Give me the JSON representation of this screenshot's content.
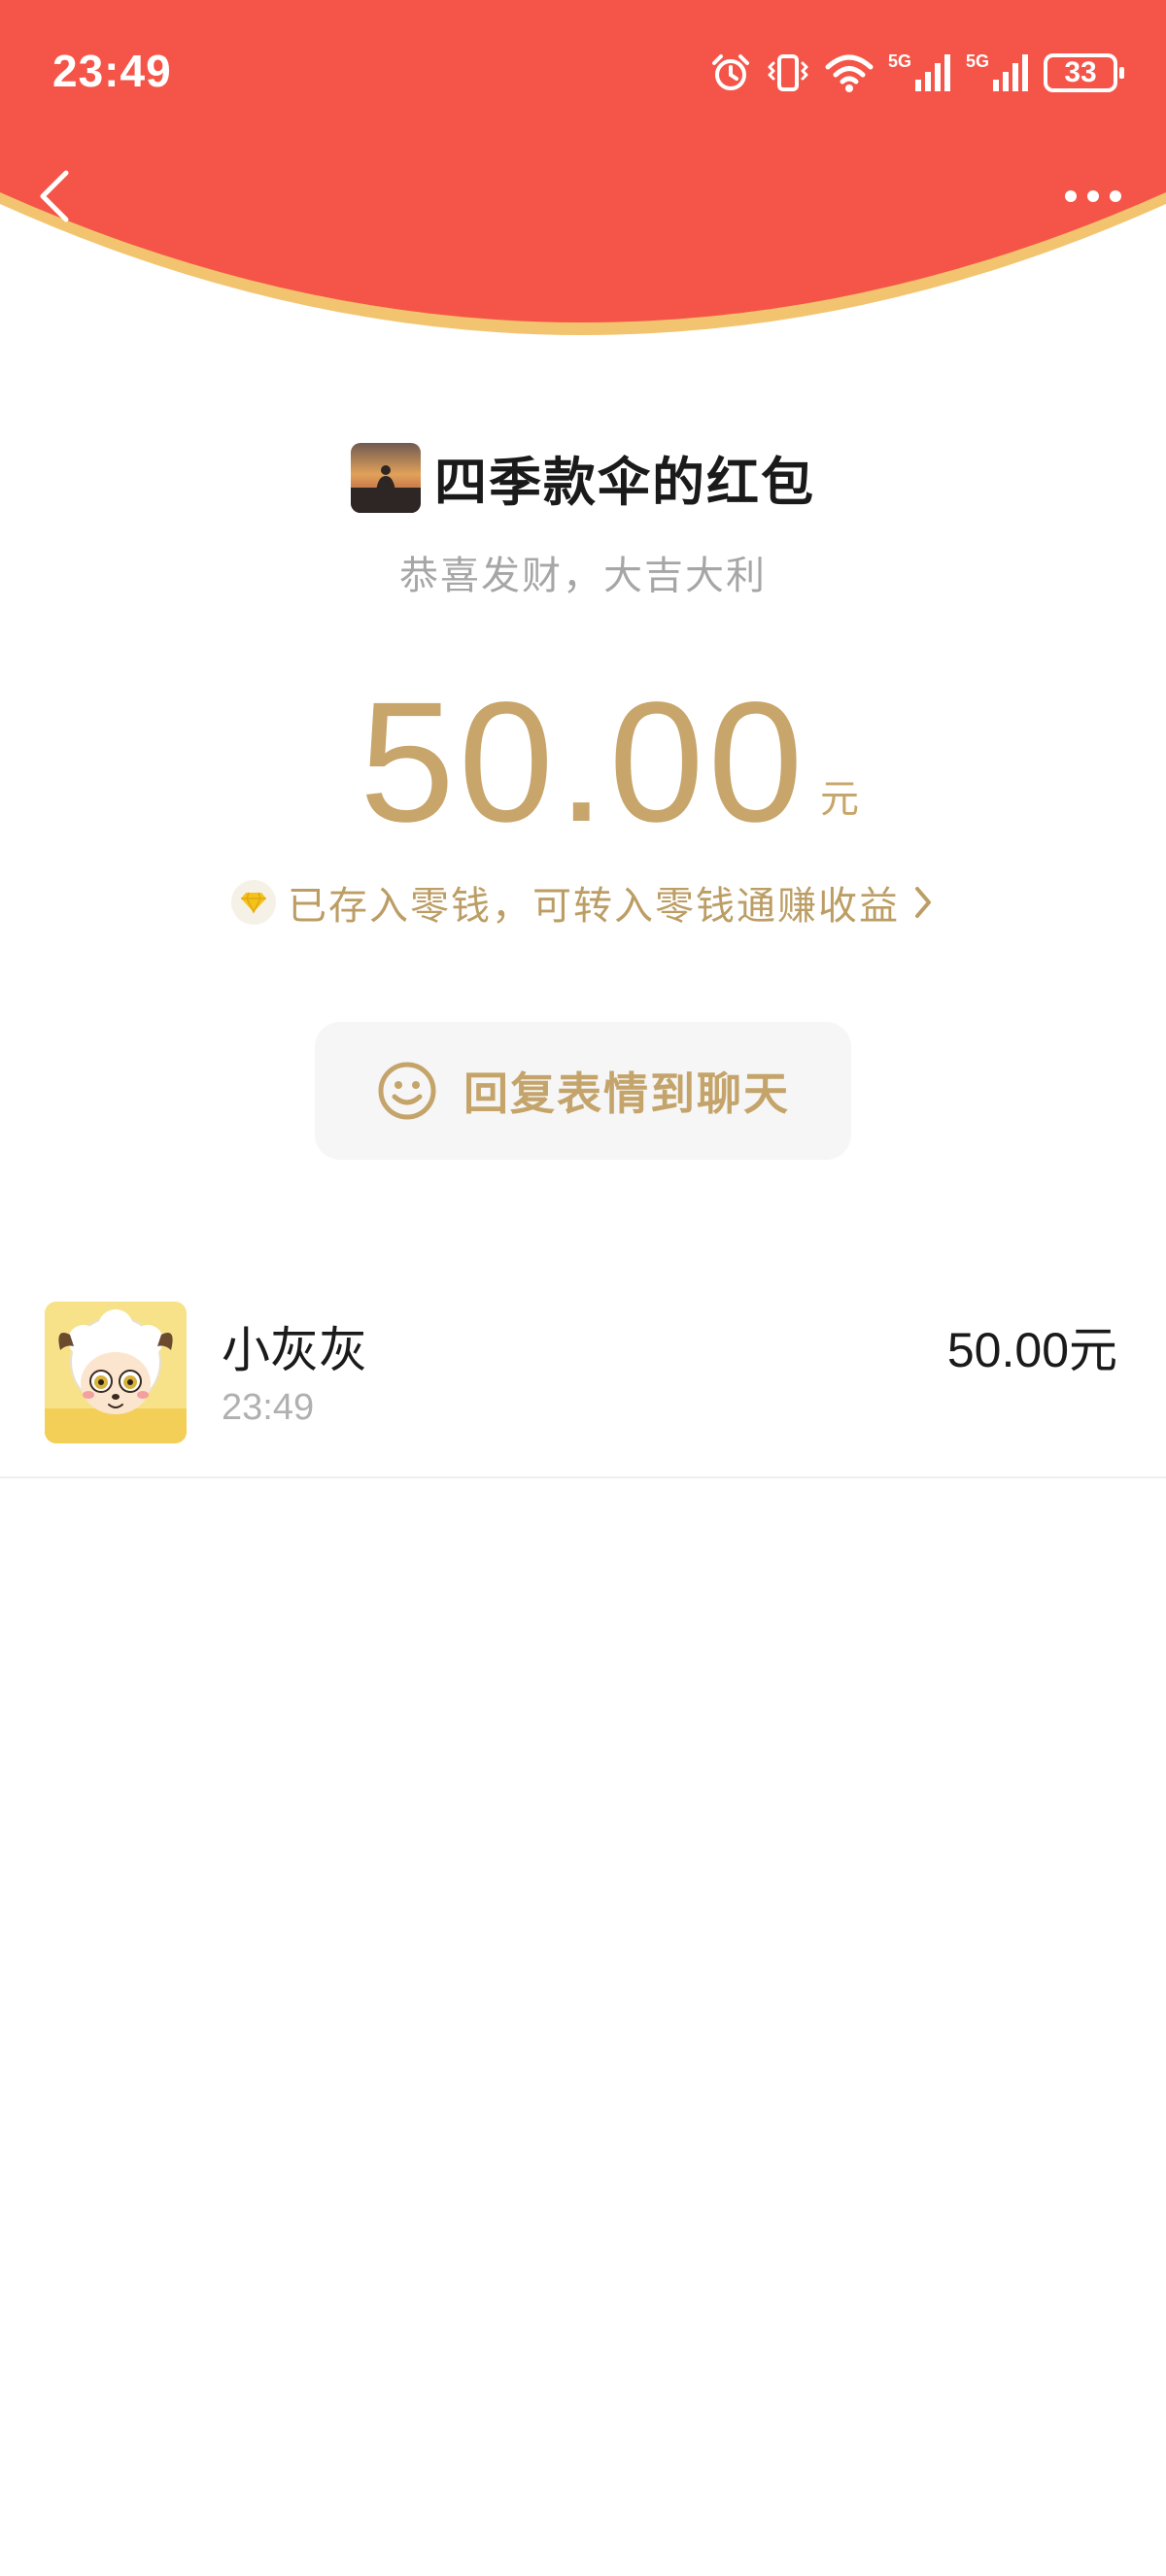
{
  "status_bar": {
    "time": "23:49",
    "network_1": "5G",
    "network_2": "5G",
    "battery": "33",
    "icons": [
      "alarm-icon",
      "vibrate-icon",
      "wifi-icon",
      "signal-5g-icon",
      "signal-5g-icon",
      "battery-icon"
    ]
  },
  "header": {
    "back_icon": "chevron-left-icon",
    "more_icon": "more-horizontal-icon",
    "color": "#f55548",
    "rim_color": "#f3c46f"
  },
  "envelope": {
    "sender_name": "四季款伞的红包",
    "greeting": "恭喜发财，大吉大利",
    "amount": "50.00",
    "unit": "元",
    "saved_text": "已存入零钱，可转入零钱通赚收益",
    "saved_icon": "diamond-icon",
    "gold_color": "#c8a56a"
  },
  "reply": {
    "icon": "smile-icon",
    "label": "回复表情到聊天"
  },
  "receivers": [
    {
      "name": "小灰灰",
      "time": "23:49",
      "amount": "50.00元"
    }
  ]
}
